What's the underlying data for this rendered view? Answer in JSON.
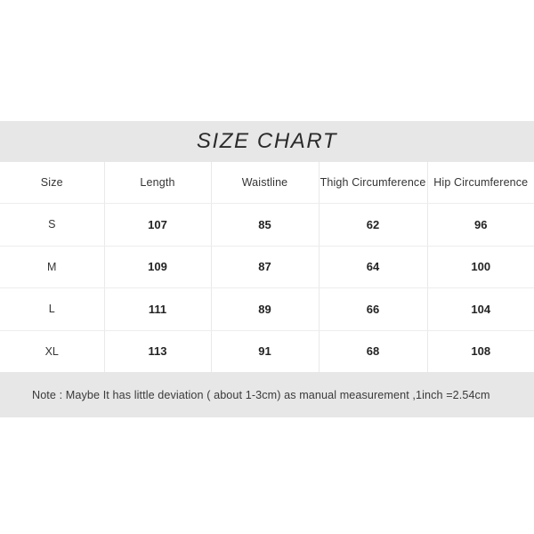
{
  "chart_data": {
    "type": "table",
    "title": "SIZE CHART",
    "columns": [
      "Size",
      "Length",
      "Waistline",
      "Thigh Circumference",
      "Hip Circumference"
    ],
    "rows": [
      [
        "S",
        "107",
        "85",
        "62",
        "96"
      ],
      [
        "M",
        "109",
        "87",
        "64",
        "100"
      ],
      [
        "L",
        "111",
        "89",
        "66",
        "104"
      ],
      [
        "XL",
        "113",
        "91",
        "68",
        "108"
      ]
    ],
    "note": "Note : Maybe It has little deviation ( about 1-3cm) as manual measurement ,1inch =2.54cm",
    "unit": "cm",
    "colors": {
      "band_background": "#e7e7e7",
      "table_background": "#ffffff",
      "divider": "#e9e9e9",
      "title_text": "#2b2b2b",
      "header_text": "#343434",
      "value_text": "#232323",
      "note_text": "#3a3a3a",
      "page_background": "#ffffff"
    }
  }
}
